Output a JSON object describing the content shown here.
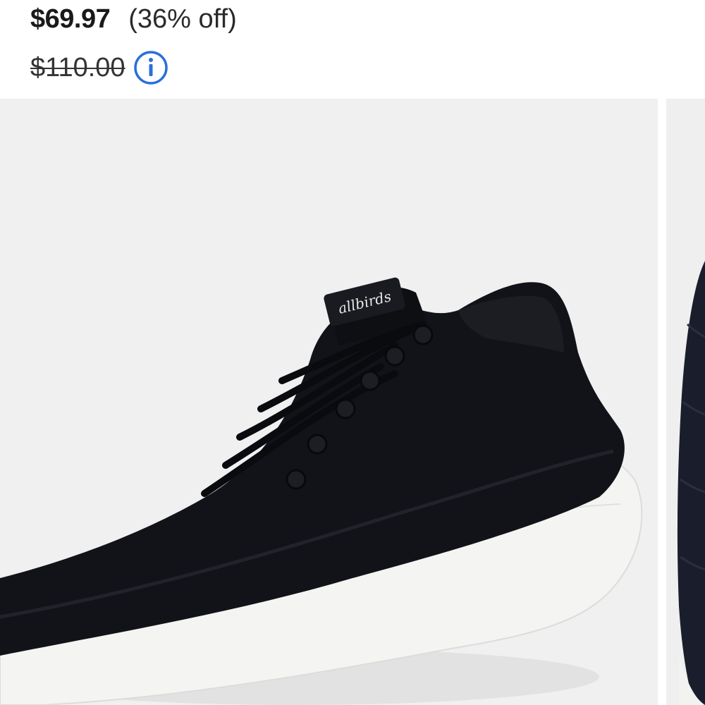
{
  "product": {
    "sale_price": "$69.97",
    "discount": "(36% off)",
    "original_price": "$110.00"
  },
  "icons": {
    "info": "info-circle-icon"
  },
  "images": {
    "main": "black-sneaker-white-sole",
    "brand_tag": "allbirds",
    "next": "black-quilted-shoe-partial"
  },
  "colors": {
    "accent": "#2a6fdb",
    "shoe": "#121318",
    "sole": "#f4f4f2",
    "background": "#f0f0f0"
  }
}
